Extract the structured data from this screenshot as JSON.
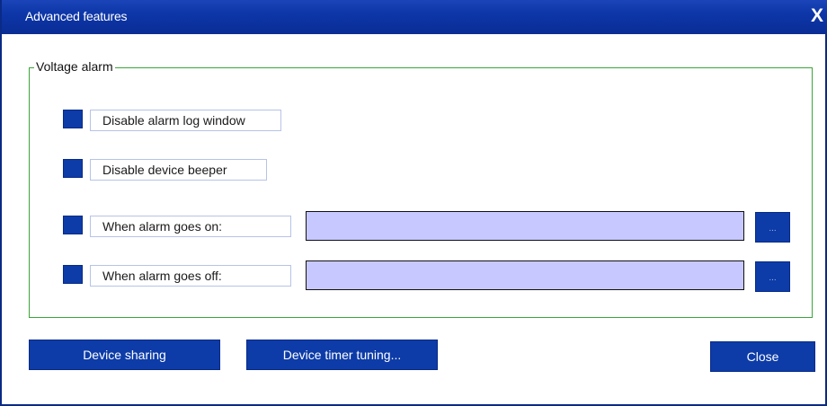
{
  "window": {
    "title": "Advanced features",
    "close_glyph": "X",
    "close_icon": "close-icon"
  },
  "group": {
    "legend": "Voltage alarm"
  },
  "options": {
    "disable_alarm_log": {
      "label": "Disable alarm log window"
    },
    "disable_beeper": {
      "label": "Disable device beeper"
    },
    "alarm_on": {
      "label": "When alarm goes on:",
      "value": "",
      "browse_label": "..."
    },
    "alarm_off": {
      "label": "When alarm goes off:",
      "value": "",
      "browse_label": "..."
    }
  },
  "buttons": {
    "device_sharing": "Device sharing",
    "device_timer_tuning": "Device timer tuning...",
    "close": "Close"
  },
  "colors": {
    "titlebar": "#0d36a8",
    "control_blue": "#0d3ca8",
    "field_fill": "#c7c8ff",
    "group_border": "#3aa53a"
  }
}
